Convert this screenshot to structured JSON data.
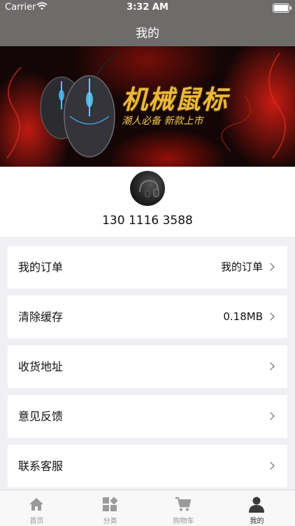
{
  "status_bar": {
    "carrier": "Carrier",
    "time": "3:32 AM",
    "battery_level": 1.0,
    "icons": [
      "wifi-icon",
      "battery-icon"
    ]
  },
  "nav": {
    "title": "我的"
  },
  "banner": {
    "title": "机械鼠标",
    "subtitle": "潮人必备 新款上市"
  },
  "profile": {
    "phone": "130 1116 3588"
  },
  "menu": [
    {
      "label": "我的订单",
      "value": "我的订单"
    },
    {
      "label": "清除缓存",
      "value": "0.18MB"
    },
    {
      "label": "收货地址",
      "value": ""
    },
    {
      "label": "意见反馈",
      "value": ""
    },
    {
      "label": "联系客服",
      "value": ""
    }
  ],
  "tabs": [
    {
      "label": "首页",
      "icon": "home-icon",
      "active": false
    },
    {
      "label": "分类",
      "icon": "category-icon",
      "active": false
    },
    {
      "label": "购物车",
      "icon": "cart-icon",
      "active": false
    },
    {
      "label": "我的",
      "icon": "profile-icon",
      "active": true
    }
  ],
  "colors": {
    "nav_bg": "#6e6b6b",
    "tab_active": "#333333",
    "tab_inactive": "#999999",
    "banner_gold": "#e8b93c"
  }
}
